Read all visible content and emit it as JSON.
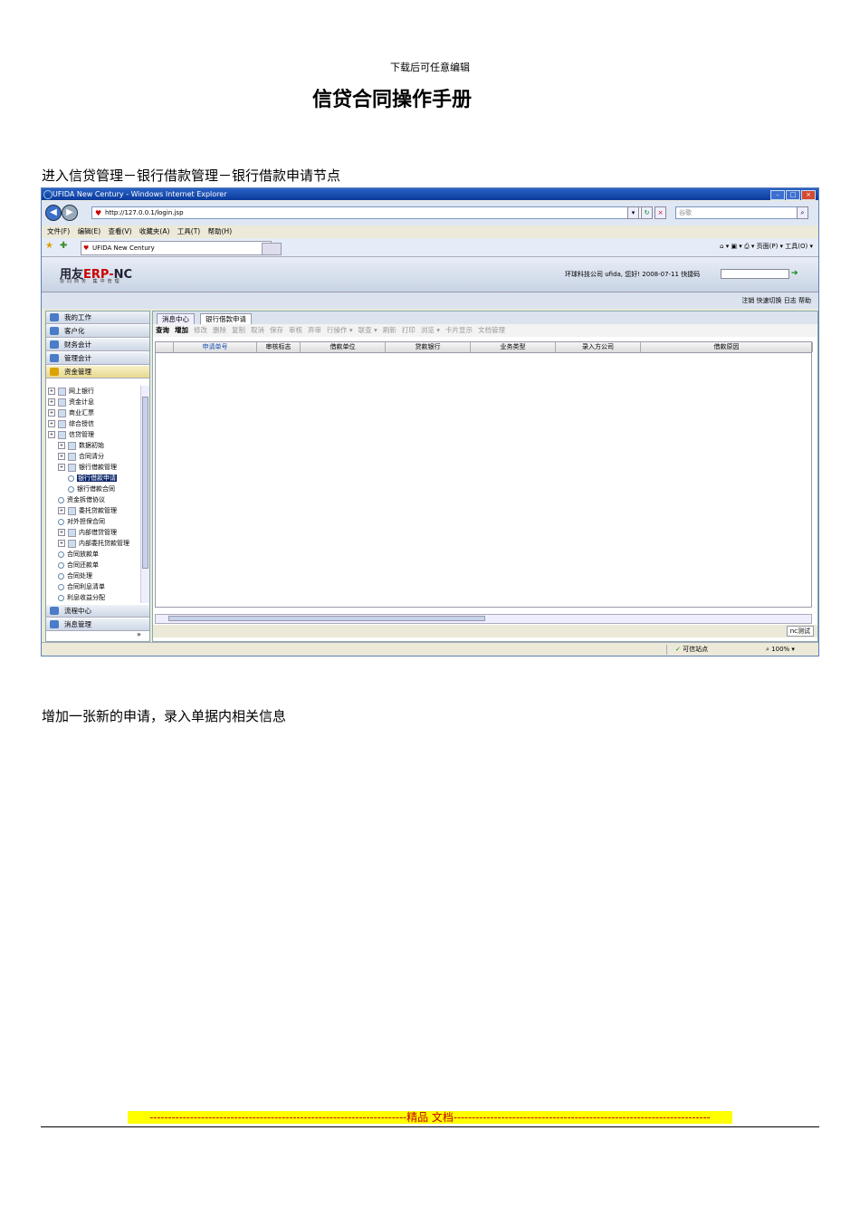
{
  "page": {
    "header_note": "下载后可任意编辑",
    "title": "信贷合同操作手册",
    "para1": "进入信贷管理－银行借款管理－银行借款申请节点",
    "para2": "增加一张新的申请，录入单据内相关信息",
    "footer": "----------------------------------------------------------------------精品  文档----------------------------------------------------------------------"
  },
  "screenshot": {
    "window_title": "UFIDA New Century - Windows Internet Explorer",
    "url": "http://127.0.0.1/login.jsp",
    "search_placeholder": "谷歌",
    "menu": [
      "文件(F)",
      "编辑(E)",
      "查看(V)",
      "收藏夹(A)",
      "工具(T)",
      "帮助(H)"
    ],
    "tab_title": "UFIDA New Century",
    "fav_tools": "页面(P) ▾  工具(O) ▾",
    "logo": {
      "main_a": "用友",
      "main_b": "ERP-",
      "main_c": "NC",
      "sub": "协同商务 集中管理"
    },
    "user_info": "环球科技公司 ufida, 您好! 2008-07-11   快捷码",
    "toolstrip_right": "注销  快速切换  日志  帮助",
    "left_nav": {
      "top_items": [
        "我的工作",
        "客户化",
        "财务会计",
        "管理会计",
        "资金管理"
      ],
      "bottom_items": [
        "流程中心",
        "消息管理"
      ],
      "tree": [
        {
          "label": "网上银行",
          "level": 0,
          "kind": "folder"
        },
        {
          "label": "资金计息",
          "level": 0,
          "kind": "folder"
        },
        {
          "label": "商业汇票",
          "level": 0,
          "kind": "folder"
        },
        {
          "label": "综合授信",
          "level": 0,
          "kind": "folder"
        },
        {
          "label": "信贷管理",
          "level": 0,
          "kind": "folder"
        },
        {
          "label": "数据初始",
          "level": 1,
          "kind": "folder"
        },
        {
          "label": "合同清分",
          "level": 1,
          "kind": "folder"
        },
        {
          "label": "银行借款管理",
          "level": 1,
          "kind": "folder"
        },
        {
          "label": "银行借款申请",
          "level": 2,
          "kind": "leaf",
          "selected": true
        },
        {
          "label": "银行借款合同",
          "level": 2,
          "kind": "leaf"
        },
        {
          "label": "资金拆借协议",
          "level": 1,
          "kind": "leaf"
        },
        {
          "label": "委托贷款管理",
          "level": 1,
          "kind": "folder"
        },
        {
          "label": "对外担保合同",
          "level": 1,
          "kind": "leaf"
        },
        {
          "label": "内部借贷管理",
          "level": 1,
          "kind": "folder"
        },
        {
          "label": "内部委托贷款管理",
          "level": 1,
          "kind": "folder"
        },
        {
          "label": "合同放款单",
          "level": 1,
          "kind": "leaf"
        },
        {
          "label": "合同还款单",
          "level": 1,
          "kind": "leaf"
        },
        {
          "label": "合同处理",
          "level": 1,
          "kind": "leaf"
        },
        {
          "label": "合同利息清单",
          "level": 1,
          "kind": "leaf"
        },
        {
          "label": "利息收益分配",
          "level": 1,
          "kind": "leaf"
        }
      ]
    },
    "main": {
      "tabs": [
        "消息中心",
        "银行借款申请"
      ],
      "buttons_enabled": [
        "查询",
        "增加"
      ],
      "buttons_disabled": [
        "修改",
        "删除",
        "复制",
        "取消",
        "保存",
        "审核",
        "弃审",
        "行操作 ▾",
        "联查 ▾",
        "刷新",
        "打印",
        "浏览 ▾",
        "卡片显示",
        "文档管理"
      ],
      "columns": [
        "申请单号",
        "审核标志",
        "借款单位",
        "贷款银行",
        "业务类型",
        "录入方公司",
        "借款原因"
      ],
      "status_right": "nc测试"
    },
    "ie_status": {
      "trusted": "可信站点",
      "zoom": "100%"
    }
  }
}
